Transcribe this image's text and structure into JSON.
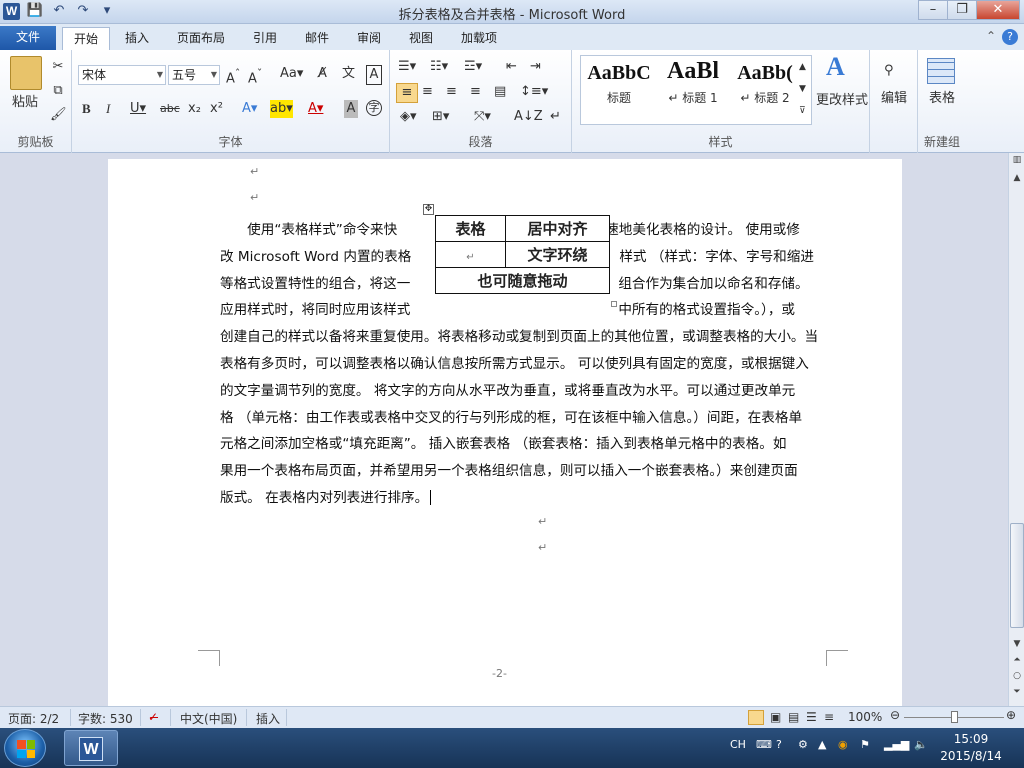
{
  "window": {
    "title": "拆分表格及合并表格 - Microsoft Word",
    "minimize": "–",
    "restore": "❐",
    "close": "✕"
  },
  "qat": {
    "save": "💾",
    "undo": "↶",
    "redo": "↷",
    "more": "▾"
  },
  "tabs": [
    {
      "label": "文件"
    },
    {
      "label": "开始"
    },
    {
      "label": "插入"
    },
    {
      "label": "页面布局"
    },
    {
      "label": "引用"
    },
    {
      "label": "邮件"
    },
    {
      "label": "审阅"
    },
    {
      "label": "视图"
    },
    {
      "label": "加载项"
    }
  ],
  "ribbon": {
    "clipboard": {
      "paste": "粘贴",
      "label": "剪贴板"
    },
    "font": {
      "name": "宋体",
      "size": "五号",
      "label": "字体"
    },
    "paragraph": {
      "label": "段落"
    },
    "styles": {
      "items": [
        {
          "sample": "AaBbC",
          "name": "标题"
        },
        {
          "sample": "AaBl",
          "name": "↵ 标题 1"
        },
        {
          "sample": "AaBb(",
          "name": "↵ 标题 2"
        }
      ],
      "change": "更改样式",
      "label": "样式"
    },
    "editing": {
      "label": "编辑"
    },
    "table": {
      "label": "表格",
      "group_label": "新建组"
    }
  },
  "document": {
    "table": {
      "r1c1": "表格",
      "r1c2": "居中对齐",
      "r2c2": "文字环绕",
      "r3": "也可随意拖动"
    },
    "lines": [
      {
        "a": "　　使用“表格样式”命令来快",
        "b": "速地美化表格的设计。 使用或修"
      },
      {
        "a": "改 Microsoft Word 内置的表格",
        "b": "样式 （样式：字体、字号和缩进"
      },
      {
        "a": "等格式设置特性的组合，将这一",
        "b": "组合作为集合加以命名和存储。"
      },
      {
        "a": "应用样式时，将同时应用该样式",
        "b": "中所有的格式设置指令。），或"
      },
      {
        "a": "创建自己的样式以备将来重复使用。将表格移动或复制到页面上的其他位置，或调整表格的大小。当"
      },
      {
        "a": "表格有多页时，可以调整表格以确认信息按所需方式显示。 可以使列具有固定的宽度，或根据键入"
      },
      {
        "a": "的文字量调节列的宽度。  将文字的方向从水平改为垂直，或将垂直改为水平。可以通过更改单元"
      },
      {
        "a": "格 （单元格：由工作表或表格中交叉的行与列形成的框，可在该框中输入信息。）间距，在表格单"
      },
      {
        "a": "元格之间添加空格或“填充距离”。 插入嵌套表格 （嵌套表格：插入到表格单元格中的表格。如"
      },
      {
        "a": "果用一个表格布局页面，并希望用另一个表格组织信息，则可以插入一个嵌套表格。）来创建页面"
      },
      {
        "a": "版式。 在表格内对列表进行排序。"
      }
    ],
    "page_number": "-2-"
  },
  "status": {
    "page": "页面: 2/2",
    "words": "字数: 530",
    "language": "中文(中国)",
    "mode": "插入",
    "zoom": "100%",
    "zoom_level": 1.0
  },
  "taskbar": {
    "ime": "CH",
    "time": "15:09",
    "date": "2015/8/14"
  }
}
